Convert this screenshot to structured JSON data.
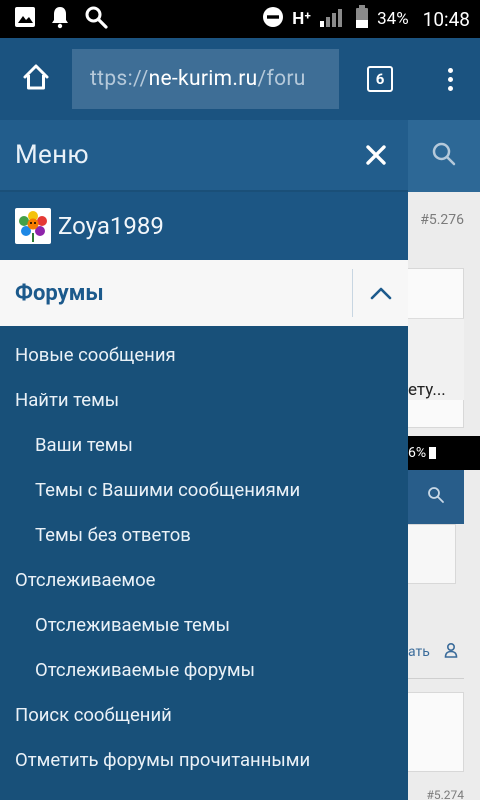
{
  "statusbar": {
    "network": "H⁺",
    "battery": "34%",
    "time": "10:48",
    "icons": [
      "image-icon",
      "bell-icon",
      "search-icon",
      "do-not-disturb-icon",
      "signal-icon",
      "battery-icon"
    ]
  },
  "browser": {
    "url_scheme": "ttps://",
    "url_host": "ne-kurim.ru",
    "url_path": "/foru",
    "tab_count": "6"
  },
  "background": {
    "post_number_top": "#5.276",
    "snippet_text": "ету...",
    "status_fragment": "6%",
    "action_fragment": "ать",
    "post_number_bottom": "#5.274"
  },
  "drawer": {
    "title": "Меню",
    "user": {
      "name": "Zoya1989"
    },
    "section_title": "Форумы",
    "items": [
      {
        "label": "Новые сообщения",
        "level": 0
      },
      {
        "label": "Найти темы",
        "level": 0
      },
      {
        "label": "Ваши темы",
        "level": 1
      },
      {
        "label": "Темы с Вашими сообщениями",
        "level": 1
      },
      {
        "label": "Темы без ответов",
        "level": 1
      },
      {
        "label": "Отслеживаемое",
        "level": 0
      },
      {
        "label": "Отслеживаемые темы",
        "level": 1
      },
      {
        "label": "Отслеживаемые форумы",
        "level": 1
      },
      {
        "label": "Поиск сообщений",
        "level": 0
      },
      {
        "label": "Отметить форумы прочитанными",
        "level": 0
      }
    ]
  },
  "colors": {
    "drawer_bg": "#185079",
    "drawer_header": "#225d8c",
    "toolbar": "#1b5380",
    "accent": "#1c5a8c"
  }
}
